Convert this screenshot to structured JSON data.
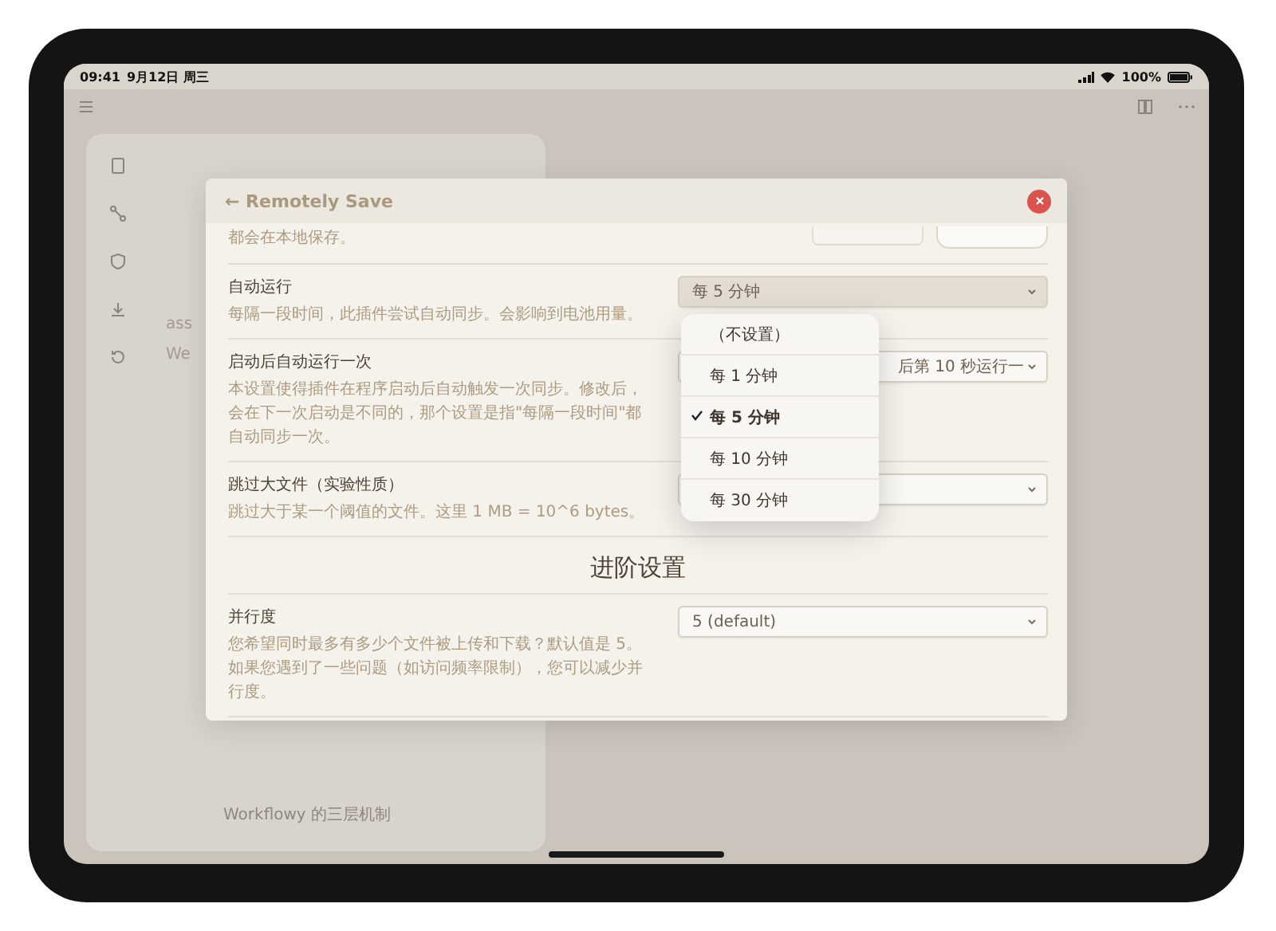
{
  "status_bar": {
    "time": "09:41",
    "date": "9月12日 周三",
    "battery": "100%"
  },
  "background": {
    "tree_items": [
      {
        "label": "ass"
      },
      {
        "label": "We"
      }
    ],
    "note_title": "Workflowy 的三层机制"
  },
  "modal": {
    "title": "← Remotely Save",
    "clipped_description": "都会在本地保存。",
    "settings": [
      {
        "kind": "select",
        "title": "自动运行",
        "description": "每隔一段时间，此插件尝试自动同步。会影响到电池用量。",
        "value": "每 5 分钟",
        "open": true
      },
      {
        "kind": "select",
        "title": "启动后自动运行一次",
        "description": "本设置使得插件在程序启动后自动触发一次同步。修改后，会在下一次启动是不同的，那个设置是指\"每隔一段时间\"都自动同步一次。",
        "value": "后第 10 秒运行一",
        "open": false
      },
      {
        "kind": "select",
        "title": "跳过大文件（实验性质）",
        "description": "跳过大于某一个阈值的文件。这里 1 MB = 10^6 bytes。",
        "open": false
      },
      {
        "kind": "heading",
        "title": "进阶设置"
      },
      {
        "kind": "select",
        "title": "并行度",
        "description": "您希望同时最多有多少个文件被上传和下载？默认值是 5。如果您遇到了一些问题（如访问频率限制），您可以减少并行度。",
        "value": "5 (default)",
        "open": false
      }
    ],
    "dropdown_options": [
      {
        "label": "（不设置）",
        "selected": false
      },
      {
        "label": "每 1 分钟",
        "selected": false
      },
      {
        "label": "每 5 分钟",
        "selected": true
      },
      {
        "label": "每 10 分钟",
        "selected": false
      },
      {
        "label": "每 30 分钟",
        "selected": false
      }
    ]
  }
}
